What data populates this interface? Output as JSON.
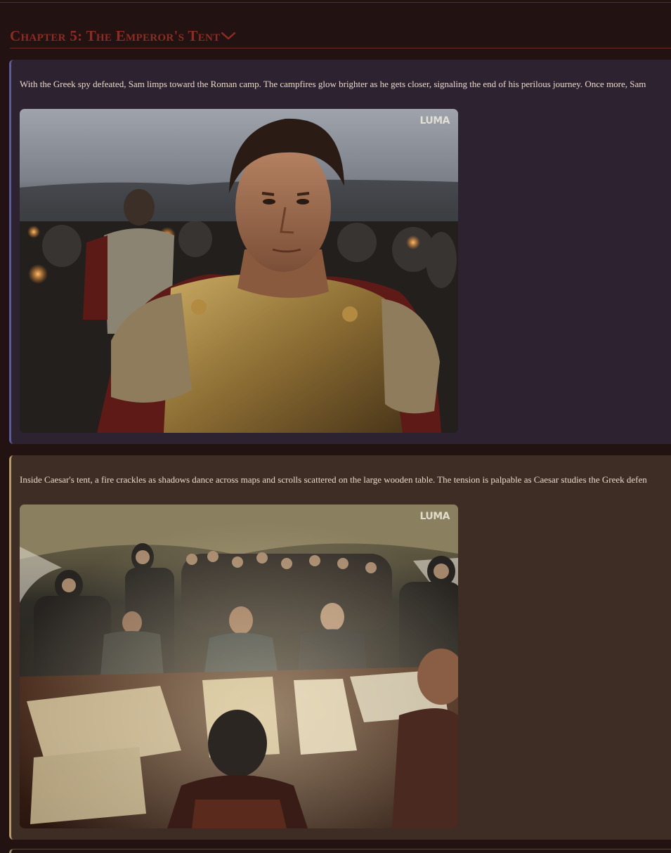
{
  "chapter": {
    "title": "Chapter 5: The Emperor's Tent",
    "toggle_icon": "chevron-down-icon",
    "accent_color": "#8e2b22"
  },
  "scenes": [
    {
      "text": "With the Greek spy defeated, Sam limps toward the Roman camp. The campfires glow brighter as he gets closer, signaling the end of his perilous journey. Once more, Sam",
      "image_watermark": "LUMA",
      "border_color": "#5a5d9a",
      "background": "#2d2230"
    },
    {
      "text": "Inside Caesar's tent, a fire crackles as shadows dance across maps and scrolls scattered on the large wooden table. The tension is palpable as Caesar studies the Greek defen",
      "image_watermark": "LUMA",
      "border_color": "#b79a68",
      "background": "#3d2d25"
    }
  ]
}
